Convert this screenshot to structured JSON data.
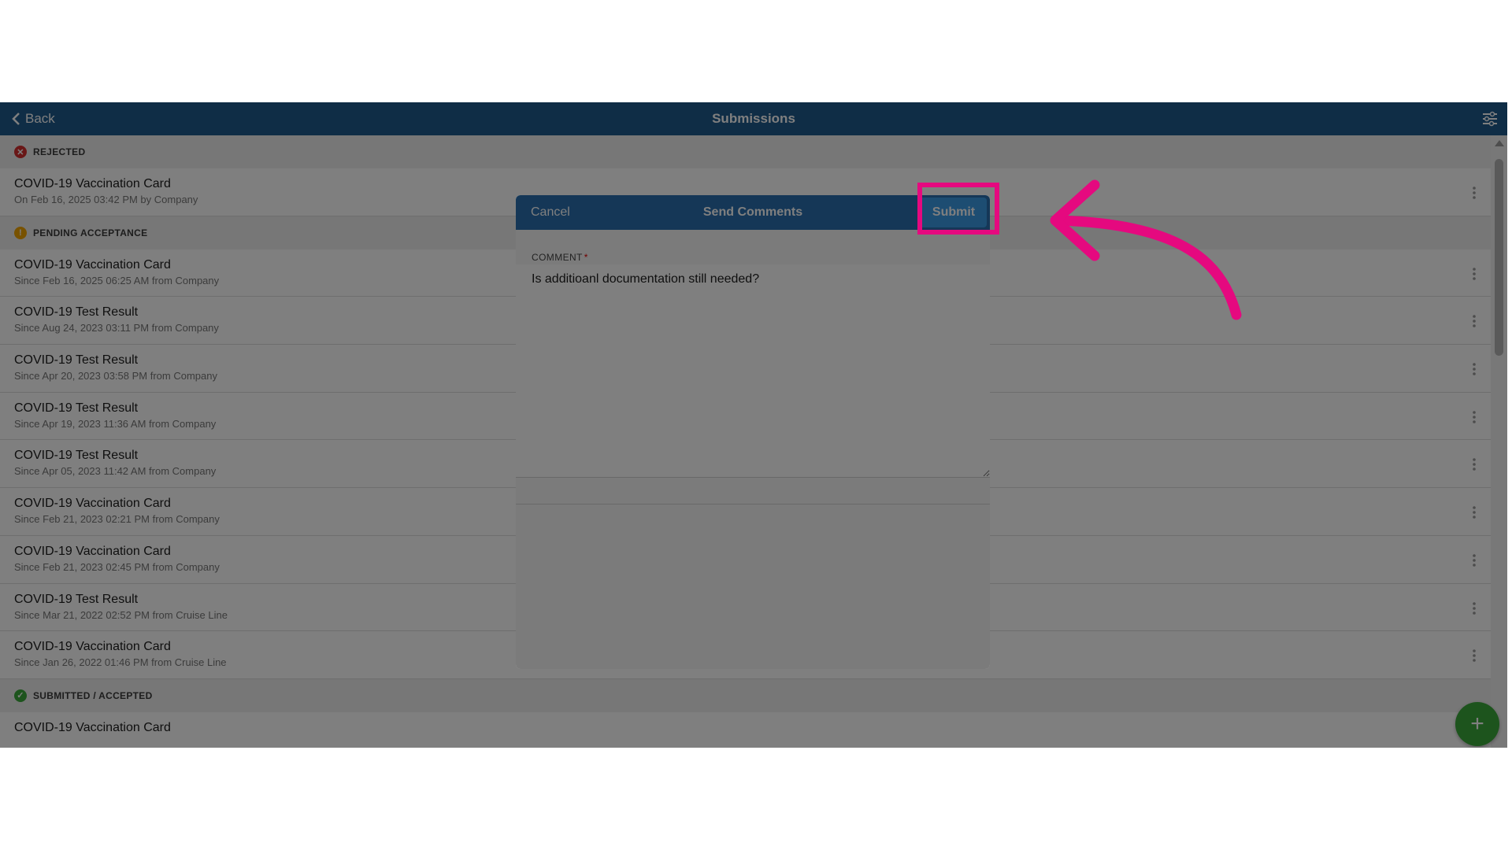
{
  "topbar": {
    "back_label": "Back",
    "title": "Submissions"
  },
  "sections": [
    {
      "status": "rejected",
      "label": "REJECTED",
      "color": "#d32f2f",
      "items": [
        {
          "title": "COVID-19 Vaccination Card",
          "subtitle": "On Feb 16, 2025 03:42 PM by Company"
        }
      ]
    },
    {
      "status": "pending",
      "label": "PENDING ACCEPTANCE",
      "color": "#f0a400",
      "items": [
        {
          "title": "COVID-19 Vaccination Card",
          "subtitle": "Since Feb 16, 2025 06:25 AM from Company"
        },
        {
          "title": "COVID-19 Test Result",
          "subtitle": "Since Aug 24, 2023 03:11 PM from Company"
        },
        {
          "title": "COVID-19 Test Result",
          "subtitle": "Since Apr 20, 2023 03:58 PM from Company"
        },
        {
          "title": "COVID-19 Test Result",
          "subtitle": "Since Apr 19, 2023 11:36 AM from Company"
        },
        {
          "title": "COVID-19 Test Result",
          "subtitle": "Since Apr 05, 2023 11:42 AM from Company"
        },
        {
          "title": "COVID-19 Vaccination Card",
          "subtitle": "Since Feb 21, 2023 02:21 PM from Company"
        },
        {
          "title": "COVID-19 Vaccination Card",
          "subtitle": "Since Feb 21, 2023 02:45 PM from Company"
        },
        {
          "title": "COVID-19 Test Result",
          "subtitle": "Since Mar 21, 2022 02:52 PM from Cruise Line"
        },
        {
          "title": "COVID-19 Vaccination Card",
          "subtitle": "Since Jan 26, 2022 01:46 PM from Cruise Line"
        }
      ]
    },
    {
      "status": "accepted",
      "label": "SUBMITTED / ACCEPTED",
      "color": "#3aa83a",
      "items": [
        {
          "title": "COVID-19 Vaccination Card",
          "subtitle": ""
        }
      ]
    }
  ],
  "modal": {
    "cancel_label": "Cancel",
    "title": "Send Comments",
    "submit_label": "Submit",
    "comment_label": "COMMENT",
    "required_mark": "*",
    "comment_value": "Is additioanl documentation still needed?"
  },
  "fab": {
    "label": "+"
  },
  "annotation": {
    "highlight_color": "#e5097f",
    "arrow_color": "#e5097f"
  }
}
